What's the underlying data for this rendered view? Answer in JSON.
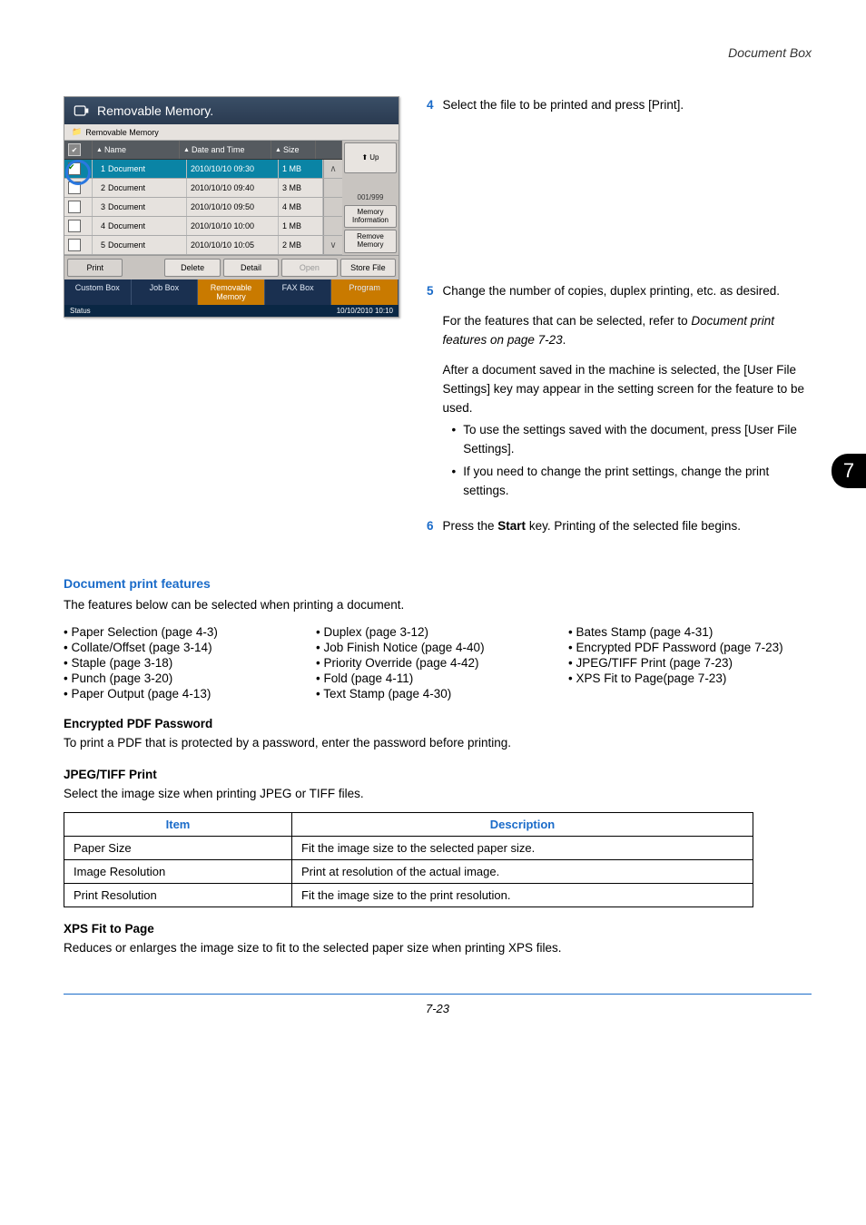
{
  "header": {
    "doc_title": "Document Box"
  },
  "side_tab": "7",
  "panel": {
    "title": "Removable Memory.",
    "breadcrumb": "Removable Memory",
    "columns": {
      "name": "Name",
      "date": "Date and Time",
      "size": "Size"
    },
    "rows": [
      {
        "idx": "1",
        "name": "Document",
        "date": "2010/10/10 09:30",
        "size": "1 MB",
        "selected": true
      },
      {
        "idx": "2",
        "name": "Document",
        "date": "2010/10/10 09:40",
        "size": "3 MB",
        "selected": false
      },
      {
        "idx": "3",
        "name": "Document",
        "date": "2010/10/10 09:50",
        "size": "4 MB",
        "selected": false
      },
      {
        "idx": "4",
        "name": "Document",
        "date": "2010/10/10 10:00",
        "size": "1 MB",
        "selected": false
      },
      {
        "idx": "5",
        "name": "Document",
        "date": "2010/10/10 10:05",
        "size": "2 MB",
        "selected": false
      }
    ],
    "page_count": "001/999",
    "side": {
      "up": "Up",
      "mem_info": "Memory Information",
      "remove": "Remove Memory"
    },
    "bottom": {
      "print": "Print",
      "delete": "Delete",
      "detail": "Detail",
      "open": "Open",
      "store": "Store File"
    },
    "tabs": {
      "custom": "Custom Box",
      "job": "Job Box",
      "removable": "Removable Memory",
      "fax": "FAX Box",
      "program": "Program"
    },
    "status": {
      "label": "Status",
      "time": "10/10/2010 10:10"
    }
  },
  "steps": {
    "s4": {
      "n": "4",
      "t": "Select the file to be printed and press [Print]."
    },
    "s5": {
      "n": "5",
      "t1": "Change the number of copies, duplex printing, etc. as desired.",
      "t2a": "For the features that can be selected, refer to ",
      "t2b": "Document print features on page 7-23",
      "t2c": ".",
      "t3": "After a document saved in the machine is selected, the [User File Settings] key may appear in the setting screen for the feature to be used.",
      "b1": "To use the settings saved with the document, press [User File Settings].",
      "b2": "If you need to change the print settings, change the print settings."
    },
    "s6": {
      "n": "6",
      "t1": "Press the ",
      "t2": "Start",
      "t3": " key. Printing of the selected file begins."
    }
  },
  "features": {
    "heading": "Document print features",
    "intro": "The features below can be selected when printing a document.",
    "col1": [
      "• Paper Selection (page 4-3)",
      "• Collate/Offset (page 3-14)",
      "• Staple (page 3-18)",
      "• Punch (page 3-20)",
      "• Paper Output (page 4-13)"
    ],
    "col2": [
      "• Duplex (page 3-12)",
      "• Job Finish Notice (page 4-40)",
      "• Priority Override (page 4-42)",
      "• Fold (page 4-11)",
      "• Text Stamp (page 4-30)"
    ],
    "col3": [
      "• Bates Stamp (page 4-31)",
      "• Encrypted PDF Password (page 7-23)",
      "• JPEG/TIFF Print (page 7-23)",
      "• XPS Fit to Page(page 7-23)"
    ]
  },
  "enc": {
    "h": "Encrypted PDF Password",
    "p": "To print a PDF that is protected by a password, enter the password before printing."
  },
  "jpg": {
    "h": "JPEG/TIFF Print",
    "p": "Select the image size when printing JPEG or TIFF files.",
    "th_item": "Item",
    "th_desc": "Description",
    "rows": [
      {
        "i": "Paper Size",
        "d": "Fit the image size to the selected paper size."
      },
      {
        "i": "Image Resolution",
        "d": "Print at resolution of the actual image."
      },
      {
        "i": "Print Resolution",
        "d": "Fit the image size to the print resolution."
      }
    ]
  },
  "xps": {
    "h": "XPS Fit to Page",
    "p": "Reduces or enlarges the image size to fit to the selected paper size when printing XPS files."
  },
  "footer": "7-23"
}
